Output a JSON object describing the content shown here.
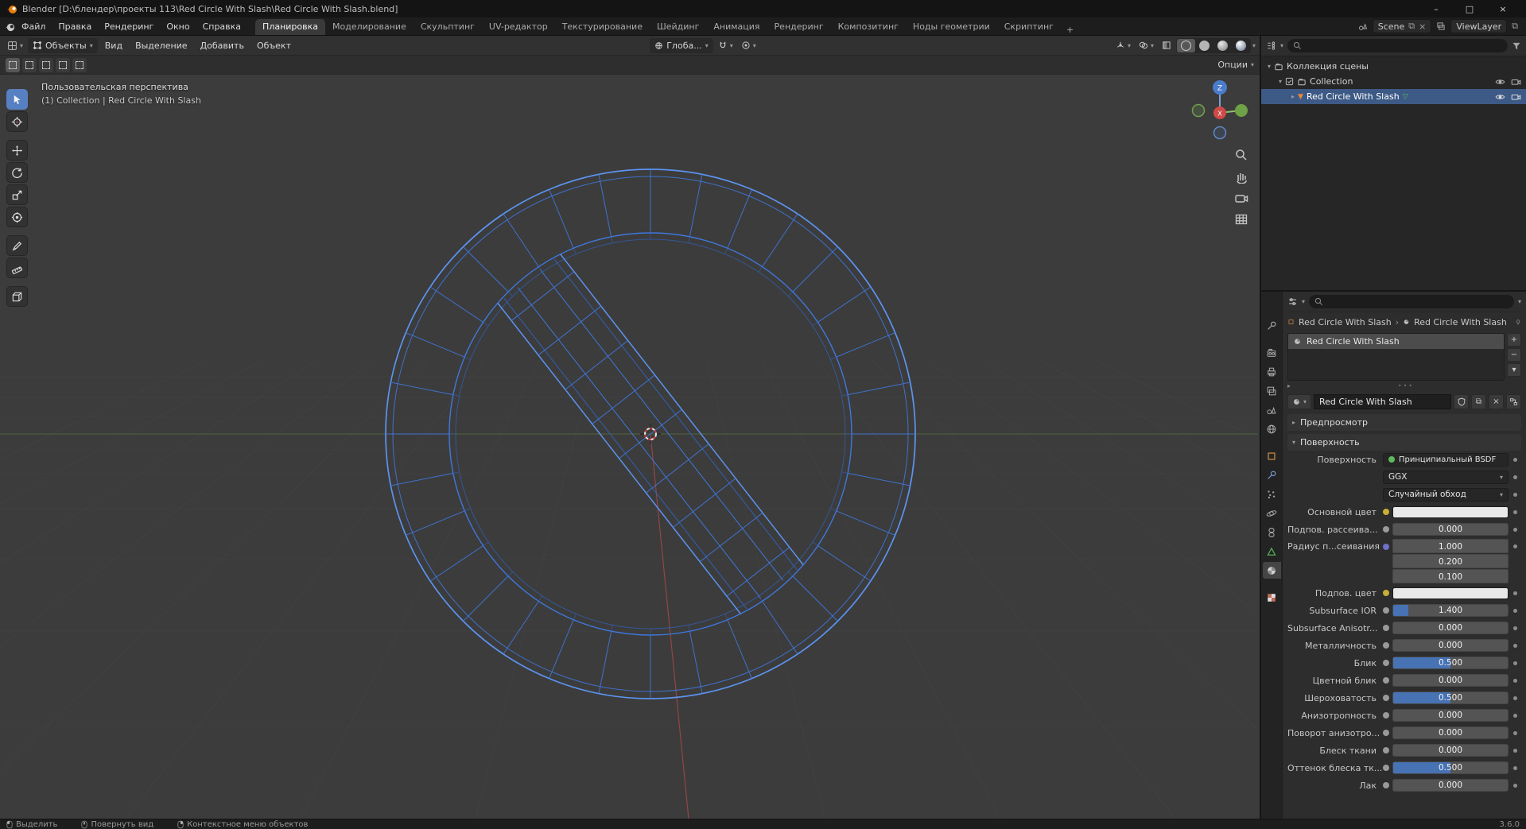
{
  "window": {
    "title": "Blender [D:\\блендер\\проекты 113\\Red Circle With Slash\\Red Circle With Slash.blend]"
  },
  "icons": {
    "minimize": "–",
    "maximize": "□",
    "close": "×",
    "chevron_down": "▾",
    "chevron_right": "▸",
    "crumb_sep": "›",
    "plus": "+",
    "minus": "−",
    "copy": "⧉",
    "grip": "•••"
  },
  "menubar": {
    "menus": [
      "Файл",
      "Правка",
      "Рендеринг",
      "Окно",
      "Справка"
    ],
    "workspaces": [
      "Планировка",
      "Моделирование",
      "Скульптинг",
      "UV-редактор",
      "Текстурирование",
      "Шейдинг",
      "Анимация",
      "Рендеринг",
      "Композитинг",
      "Ноды геометрии",
      "Скриптинг"
    ],
    "active_workspace": "Планировка",
    "scene_label": "Scene",
    "viewlayer_label": "ViewLayer"
  },
  "viewport": {
    "mode": "Объекты",
    "menus": [
      "Вид",
      "Выделение",
      "Добавить",
      "Объект"
    ],
    "orientation": "Глоба...",
    "options_label": "Опции",
    "overlay": {
      "line1": "Пользовательская перспектива",
      "line2": "(1) Collection | Red Circle With Slash"
    },
    "gizmo": {
      "z": "Z",
      "x": "X"
    }
  },
  "tools": [
    "select-box",
    "cursor",
    "move",
    "rotate",
    "scale",
    "transform",
    "annotate",
    "measure",
    "add-cube"
  ],
  "outliner": {
    "rows": [
      {
        "label": "Коллекция сцены"
      },
      {
        "label": "Collection"
      },
      {
        "label": "Red Circle With Slash",
        "selected": true
      }
    ]
  },
  "properties": {
    "breadcrumb": {
      "object": "Red Circle With Slash",
      "material": "Red Circle With Slash"
    },
    "slot": "Red Circle With Slash",
    "material_name": "Red Circle With Slash",
    "preview_label": "Предпросмотр",
    "surface_label": "Поверхность",
    "surface_row": {
      "label": "Поверхность",
      "value": "Принципиальный BSDF"
    },
    "distribution": "GGX",
    "sss_method": "Случайный обход",
    "fields": [
      {
        "label": "Основной цвет",
        "type": "color"
      },
      {
        "label": "Подпов. рассеива...",
        "type": "slider",
        "value": "0.000",
        "fill": 0
      },
      {
        "label": "Радиус п...сеивания",
        "type": "vector",
        "values": [
          "1.000",
          "0.200",
          "0.100"
        ]
      },
      {
        "label": "Подпов. цвет",
        "type": "color"
      },
      {
        "label": "Subsurface IOR",
        "type": "slider",
        "value": "1.400",
        "fill": 0.13
      },
      {
        "label": "Subsurface Anisotr...",
        "type": "slider",
        "value": "0.000",
        "fill": 0
      },
      {
        "label": "Металличность",
        "type": "slider",
        "value": "0.000",
        "fill": 0
      },
      {
        "label": "Блик",
        "type": "slider",
        "value": "0.500",
        "fill": 0.5
      },
      {
        "label": "Цветной блик",
        "type": "slider",
        "value": "0.000",
        "fill": 0
      },
      {
        "label": "Шероховатость",
        "type": "slider",
        "value": "0.500",
        "fill": 0.5
      },
      {
        "label": "Анизотропность",
        "type": "slider",
        "value": "0.000",
        "fill": 0
      },
      {
        "label": "Поворот анизотро...",
        "type": "slider",
        "value": "0.000",
        "fill": 0
      },
      {
        "label": "Блеск ткани",
        "type": "slider",
        "value": "0.000",
        "fill": 0
      },
      {
        "label": "Оттенок блеска тк...",
        "type": "slider",
        "value": "0.500",
        "fill": 0.5
      },
      {
        "label": "Лак",
        "type": "slider",
        "value": "0.000",
        "fill": 0
      }
    ]
  },
  "statusbar": {
    "hints": [
      "Выделить",
      "Повернуть вид",
      "Контекстное меню объектов"
    ],
    "version": "3.6.0"
  },
  "colors": {
    "accent": "#4772b3",
    "selection": "#3d5a86",
    "wire": "#3f77dc",
    "wire_bright": "#5c93f0",
    "axis_x": "#c84b4b",
    "axis_y": "#6fa146",
    "axis_z": "#3a6bc4"
  }
}
